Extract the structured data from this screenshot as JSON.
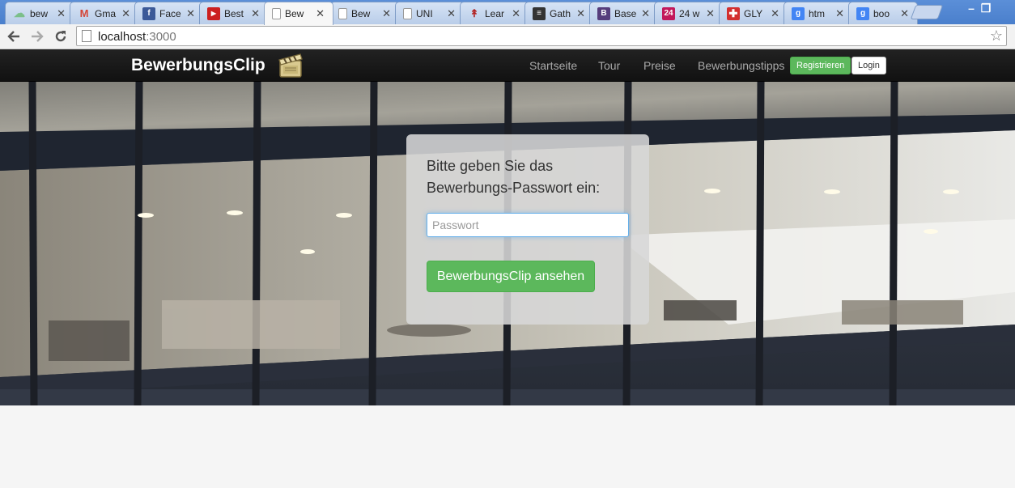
{
  "browser": {
    "tabs": [
      {
        "title": "bew",
        "icon": "cloud-icon",
        "color": "#7bbf8a"
      },
      {
        "title": "Gma",
        "icon": "gmail-icon",
        "color": "#d44638"
      },
      {
        "title": "Face",
        "icon": "facebook-icon",
        "color": "#3b5998"
      },
      {
        "title": "Best",
        "icon": "youtube-icon",
        "color": "#cc2020"
      },
      {
        "title": "Bew",
        "icon": "page-icon",
        "color": "#ffffff",
        "active": true
      },
      {
        "title": "Bew",
        "icon": "page-icon",
        "color": "#ffffff"
      },
      {
        "title": "UNI",
        "icon": "page-icon",
        "color": "#ffffff"
      },
      {
        "title": "Lear",
        "icon": "rails-icon",
        "color": "#b22222"
      },
      {
        "title": "Gath",
        "icon": "document-icon",
        "color": "#333333"
      },
      {
        "title": "Base",
        "icon": "bootstrap-icon",
        "color": "#563d7c"
      },
      {
        "title": "24 w",
        "icon": "24-icon",
        "color": "#c2185b"
      },
      {
        "title": "GLY",
        "icon": "cross-icon",
        "color": "#d32f2f"
      },
      {
        "title": "htm",
        "icon": "google-icon",
        "color": "#4285f4"
      },
      {
        "title": "boo",
        "icon": "google-icon",
        "color": "#4285f4"
      }
    ],
    "url_host": "localhost",
    "url_port": ":3000"
  },
  "navbar": {
    "brand": "BewerbungsClip",
    "links": [
      "Startseite",
      "Tour",
      "Preise",
      "Bewerbungstipps"
    ],
    "register_label": "Registrieren",
    "login_label": "Login"
  },
  "form": {
    "prompt": "Bitte geben Sie das Bewerbungs-Passwort ein:",
    "password_placeholder": "Passwort",
    "password_value": "",
    "submit_label": "BewerbungsClip ansehen"
  },
  "colors": {
    "primary_green": "#5cb85c",
    "navbar_bg": "#1a1a1a",
    "focus_blue": "#66afe9"
  }
}
